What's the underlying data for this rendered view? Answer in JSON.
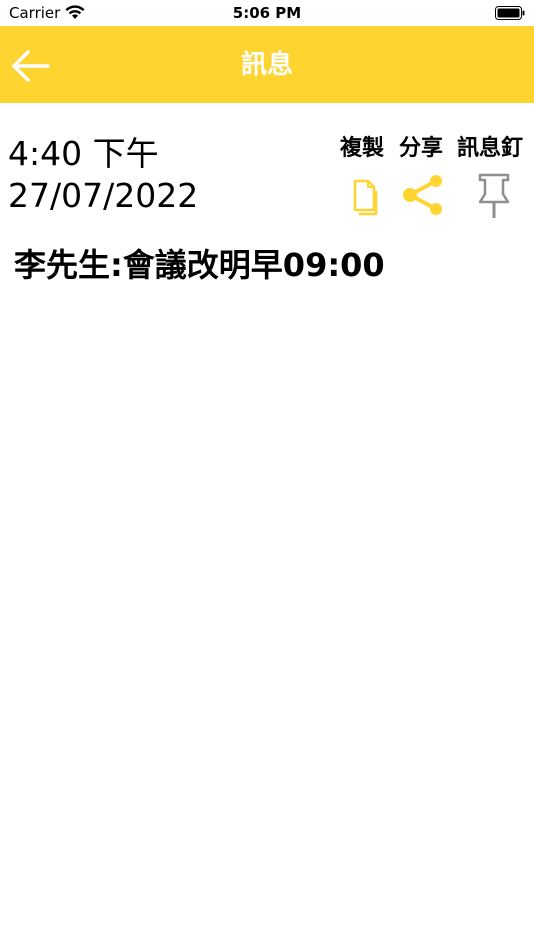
{
  "status": {
    "carrier": "Carrier",
    "time": "5:06 PM"
  },
  "nav": {
    "title": "訊息"
  },
  "message": {
    "time": "4:40 下午",
    "date": "27/07/2022",
    "text": "李先生:會議改明早09:00"
  },
  "actions": {
    "copy": "複製",
    "share": "分享",
    "pin": "訊息釘"
  },
  "colors": {
    "accent": "#fed530",
    "pin_gray": "#8e8e8e"
  },
  "icons": [
    "back-arrow-icon",
    "copy-icon",
    "share-icon",
    "pin-icon",
    "wifi-icon",
    "battery-icon"
  ]
}
